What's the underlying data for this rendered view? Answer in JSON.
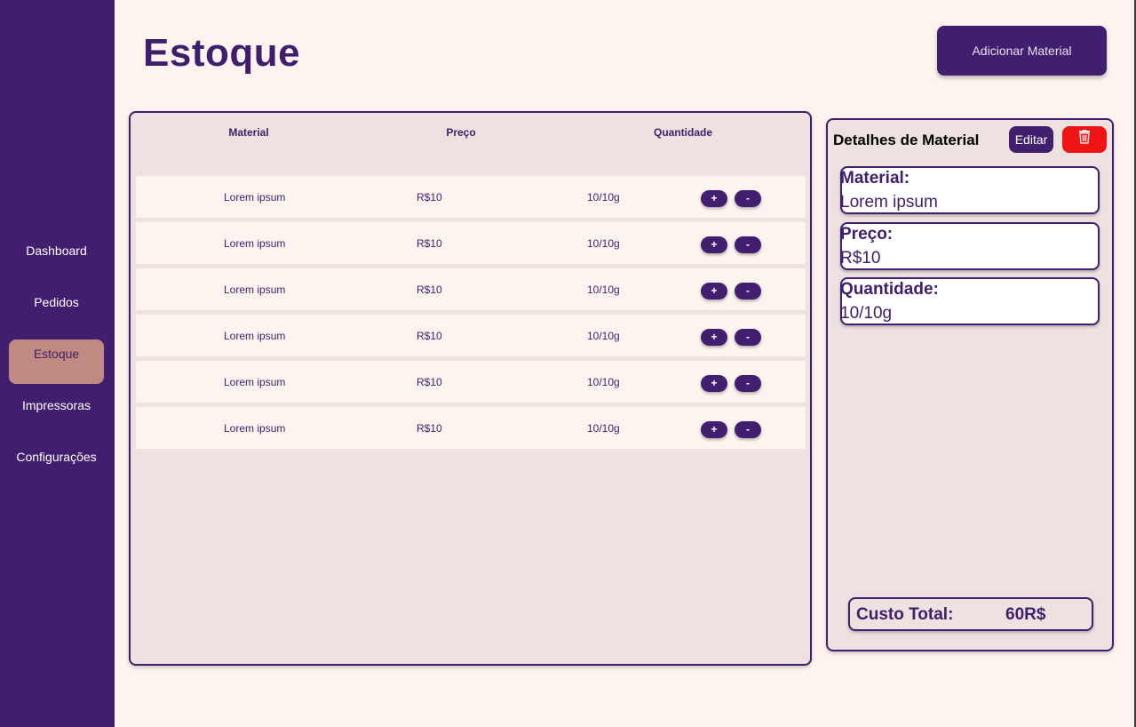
{
  "colors": {
    "primary": "#411f6e",
    "background": "#fdf4ef",
    "panel": "#ede2df",
    "active_nav": "#c08a82",
    "danger": "#f01515"
  },
  "sidebar": {
    "items": [
      {
        "label": "Dashboard",
        "active": false
      },
      {
        "label": "Pedidos",
        "active": false
      },
      {
        "label": "Estoque",
        "active": true
      },
      {
        "label": "Impressoras",
        "active": false
      },
      {
        "label": "Configurações",
        "active": false
      }
    ]
  },
  "header": {
    "title": "Estoque",
    "add_button_label": "Adicionar Material"
  },
  "table": {
    "columns": [
      "Material",
      "Preço",
      "Quantidade"
    ],
    "rows": [
      {
        "material": "Lorem ipsum",
        "preco": "R$10",
        "quantidade": "10/10g",
        "plus": "+",
        "minus": "-"
      },
      {
        "material": "Lorem ipsum",
        "preco": "R$10",
        "quantidade": "10/10g",
        "plus": "+",
        "minus": "-"
      },
      {
        "material": "Lorem ipsum",
        "preco": "R$10",
        "quantidade": "10/10g",
        "plus": "+",
        "minus": "-"
      },
      {
        "material": "Lorem ipsum",
        "preco": "R$10",
        "quantidade": "10/10g",
        "plus": "+",
        "minus": "-"
      },
      {
        "material": "Lorem ipsum",
        "preco": "R$10",
        "quantidade": "10/10g",
        "plus": "+",
        "minus": "-"
      },
      {
        "material": "Lorem ipsum",
        "preco": "R$10",
        "quantidade": "10/10g",
        "plus": "+",
        "minus": "-"
      }
    ]
  },
  "details": {
    "title": "Detalhes de Material",
    "edit_label": "Editar",
    "delete_icon": "trash-icon",
    "fields": [
      {
        "label": "Material:",
        "value": "Lorem ipsum"
      },
      {
        "label": "Preço:",
        "value": "R$10"
      },
      {
        "label": "Quantidade:",
        "value": "10/10g"
      }
    ],
    "total_label": "Custo Total:",
    "total_value": "60R$"
  }
}
